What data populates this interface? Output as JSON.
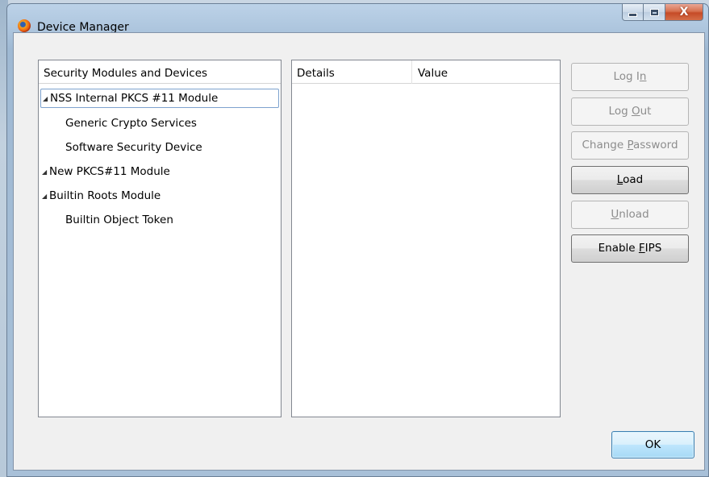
{
  "window": {
    "title": "Device Manager",
    "app_icon": "firefox-icon",
    "controls": {
      "minimize": "minimize-icon",
      "maximize": "maximize-icon",
      "close": "X"
    }
  },
  "tree": {
    "header": "Security Modules and Devices",
    "items": [
      {
        "label": "NSS Internal PKCS #11 Module",
        "expanded": true,
        "selected": true,
        "children": [
          "Generic Crypto Services",
          "Software Security Device"
        ]
      },
      {
        "label": "New PKCS#11 Module",
        "expanded": true,
        "selected": false,
        "children": []
      },
      {
        "label": "Builtin Roots Module",
        "expanded": true,
        "selected": false,
        "children": [
          "Builtin Object Token"
        ]
      }
    ],
    "twisty_glyph": "◢"
  },
  "details": {
    "columns": [
      "Details",
      "Value"
    ],
    "rows": []
  },
  "buttons": {
    "log_in": {
      "pre": "Log I",
      "key": "n",
      "post": "",
      "enabled": false
    },
    "log_out": {
      "pre": "Log ",
      "key": "O",
      "post": "ut",
      "enabled": false
    },
    "change_password": {
      "pre": "Change ",
      "key": "P",
      "post": "assword",
      "enabled": false
    },
    "load": {
      "pre": "",
      "key": "L",
      "post": "oad",
      "enabled": true
    },
    "unload": {
      "pre": "",
      "key": "U",
      "post": "nload",
      "enabled": false
    },
    "enable_fips": {
      "pre": "Enable ",
      "key": "F",
      "post": "IPS",
      "enabled": true
    },
    "ok": "OK"
  },
  "colors": {
    "window_frame": "#aec6de",
    "client_bg": "#f0f0f0",
    "disabled_text": "#8d8d8d",
    "selection_border": "#7da2ce",
    "default_button_border": "#3c7fb1"
  }
}
